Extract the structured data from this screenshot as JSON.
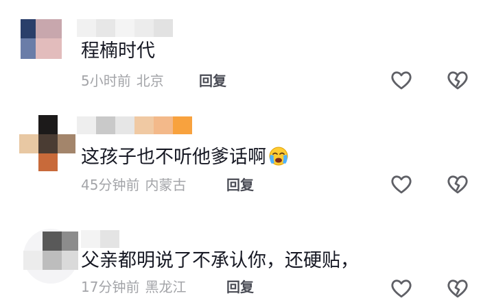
{
  "comments": [
    {
      "text": "程楠时代",
      "time": "5小时前",
      "location": "北京",
      "reply_label": "回复"
    },
    {
      "text": "这孩子也不听他爹话啊",
      "time": "45分钟前",
      "location": "内蒙古",
      "reply_label": "回复",
      "emoji": "crying-face"
    },
    {
      "text": "父亲都明说了不承认你，还硬贴，",
      "time": "17分钟前",
      "location": "黑龙江",
      "reply_label": "回复"
    }
  ],
  "icons": {
    "like": "heart-outline-icon",
    "dislike": "broken-heart-outline-icon"
  },
  "colors": {
    "text": "#161823",
    "meta": "#a3a4a8",
    "reply": "#4a4c55",
    "icon": "#5f6066"
  }
}
